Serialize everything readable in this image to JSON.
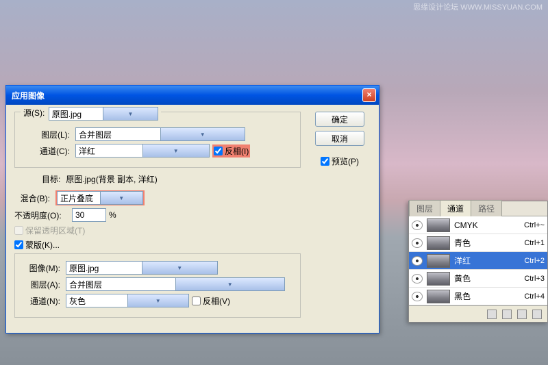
{
  "watermark": "思缘设计论坛  WWW.MISSYUAN.COM",
  "dialog": {
    "title": "应用图像",
    "source_legend": "源(S):",
    "source_value": "原图.jpg",
    "layer_label": "图层(L):",
    "layer_value": "合并图层",
    "channel_label": "通道(C):",
    "channel_value": "洋红",
    "invert1_label": "反相(I)",
    "target_label": "目标:",
    "target_value": "原图.jpg(背景 副本, 洋红)",
    "blend_label": "混合(B):",
    "blend_value": "正片叠底",
    "opacity_label": "不透明度(O):",
    "opacity_value": "30",
    "opacity_pct": "%",
    "preserve_label": "保留透明区域(T)",
    "mask_label": "蒙版(K)...",
    "image_label": "图像(M):",
    "image_value": "原图.jpg",
    "layer2_label": "图层(A):",
    "layer2_value": "合并图层",
    "channel2_label": "通道(N):",
    "channel2_value": "灰色",
    "invert2_label": "反相(V)",
    "ok": "确定",
    "cancel": "取消",
    "preview": "预览(P)"
  },
  "panel": {
    "tab_layers": "图层",
    "tab_channels": "通道",
    "tab_paths": "路径",
    "channels": [
      {
        "name": "CMYK",
        "short": "Ctrl+~"
      },
      {
        "name": "青色",
        "short": "Ctrl+1"
      },
      {
        "name": "洋红",
        "short": "Ctrl+2"
      },
      {
        "name": "黄色",
        "short": "Ctrl+3"
      },
      {
        "name": "黑色",
        "short": "Ctrl+4"
      }
    ]
  }
}
